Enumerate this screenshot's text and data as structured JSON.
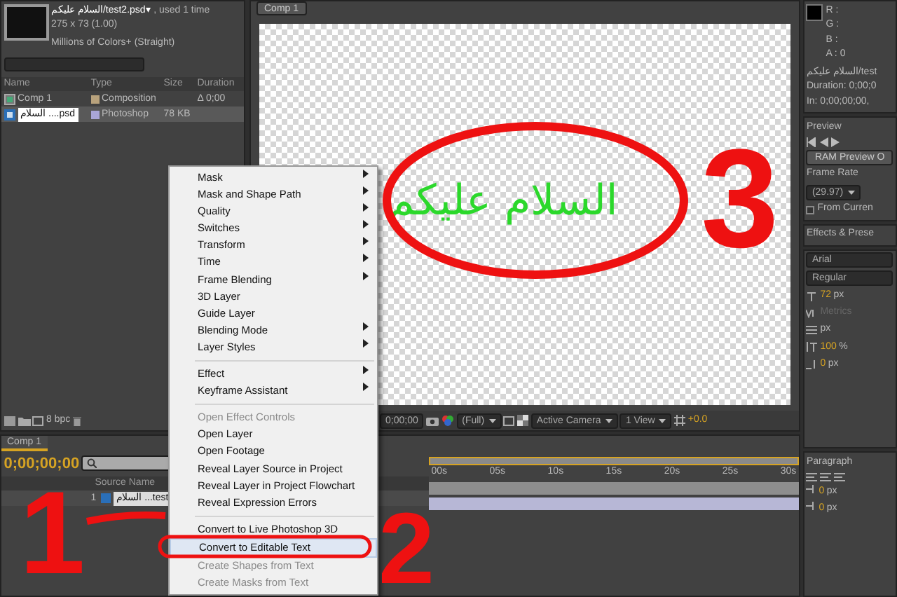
{
  "project": {
    "footage_name": "السلام عليكم/test2.psd▾",
    "footage_usage": ", used 1 time",
    "dimensions": "275 x 73 (1.00)",
    "color_depth": "Millions of Colors+ (Straight)",
    "columns": [
      "Name",
      "Type",
      "Size",
      "Duration"
    ],
    "items": [
      {
        "name": "Comp 1",
        "type": "Composition",
        "duration": "Δ 0;00",
        "color": "#b8a27c",
        "kind": "comp",
        "selected": false
      },
      {
        "name": "السلام ....psd",
        "type": "Photoshop",
        "size": "78 KB",
        "color": "#a9a6d6",
        "kind": "footage",
        "selected": true
      }
    ],
    "bit_depth": "8 bpc"
  },
  "viewer": {
    "tab": "Comp 1",
    "canvas_text": "السلام عليكم",
    "timecode": "0;00;00",
    "resolution": "(Full)",
    "camera": "Active Camera",
    "views": "1 View",
    "exposure": "+0.0"
  },
  "context_menu": {
    "groups": [
      [
        {
          "label": "Mask",
          "submenu": true,
          "disabled": false,
          "selected": false
        },
        {
          "label": "Mask and Shape Path",
          "submenu": true,
          "disabled": false,
          "selected": false
        },
        {
          "label": "Quality",
          "submenu": true,
          "disabled": false,
          "selected": false
        },
        {
          "label": "Switches",
          "submenu": true,
          "disabled": false,
          "selected": false
        },
        {
          "label": "Transform",
          "submenu": true,
          "disabled": false,
          "selected": false
        },
        {
          "label": "Time",
          "submenu": true,
          "disabled": false,
          "selected": false
        },
        {
          "label": "Frame Blending",
          "submenu": true,
          "disabled": false,
          "selected": false
        },
        {
          "label": "3D Layer",
          "submenu": false,
          "disabled": false,
          "selected": false
        },
        {
          "label": "Guide Layer",
          "submenu": false,
          "disabled": false,
          "selected": false
        },
        {
          "label": "Blending Mode",
          "submenu": true,
          "disabled": false,
          "selected": false
        },
        {
          "label": "Layer Styles",
          "submenu": true,
          "disabled": false,
          "selected": false
        }
      ],
      [
        {
          "label": "Effect",
          "submenu": true,
          "disabled": false,
          "selected": false
        },
        {
          "label": "Keyframe Assistant",
          "submenu": true,
          "disabled": false,
          "selected": false
        }
      ],
      [
        {
          "label": "Open Effect Controls",
          "submenu": false,
          "disabled": true,
          "selected": false
        },
        {
          "label": "Open Layer",
          "submenu": false,
          "disabled": false,
          "selected": false
        },
        {
          "label": "Open Footage",
          "submenu": false,
          "disabled": false,
          "selected": false
        },
        {
          "label": "Reveal Layer Source in Project",
          "submenu": false,
          "disabled": false,
          "selected": false
        },
        {
          "label": "Reveal Layer in Project Flowchart",
          "submenu": false,
          "disabled": false,
          "selected": false
        },
        {
          "label": "Reveal Expression Errors",
          "submenu": false,
          "disabled": false,
          "selected": false
        }
      ],
      [
        {
          "label": "Convert to Live Photoshop 3D",
          "submenu": false,
          "disabled": false,
          "selected": false
        },
        {
          "label": "Convert to Editable Text",
          "submenu": false,
          "disabled": false,
          "selected": true
        },
        {
          "label": "Create Shapes from Text",
          "submenu": false,
          "disabled": true,
          "selected": false
        },
        {
          "label": "Create Masks from Text",
          "submenu": false,
          "disabled": true,
          "selected": false
        }
      ]
    ]
  },
  "timeline": {
    "tab": "Comp 1",
    "timecode": "0;00;00;00",
    "source_header": "Source Name",
    "layer_number": "1",
    "layer_name": "السلام ...test",
    "ruler": [
      "00s",
      "05s",
      "10s",
      "15s",
      "20s",
      "25s",
      "30s"
    ]
  },
  "info": {
    "channels": [
      "R :",
      "G :",
      "B :",
      "A : 0"
    ],
    "layer": "السلام عليكم/test",
    "duration": "Duration: 0;00;0",
    "in_point": "In: 0;00;00;00,"
  },
  "preview": {
    "tab": "Preview",
    "ram_button": "RAM Preview O",
    "frame_rate_label": "Frame Rate",
    "frame_rate": "(29.97)",
    "from_current": "From Curren",
    "from_current_checked": false
  },
  "effects": {
    "tab": "Effects & Prese"
  },
  "character": {
    "font": "Arial",
    "style": "Regular",
    "size": "72",
    "size_unit": "px",
    "kerning": "Metrics",
    "leading_unit": "px",
    "scale": "100",
    "scale_unit": "%",
    "shift": "0",
    "shift_unit": "px"
  },
  "paragraph": {
    "tab": "Paragraph",
    "indents": [
      {
        "value": "0",
        "unit": "px"
      },
      {
        "value": "0",
        "unit": "px"
      }
    ]
  },
  "annotations": [
    "3",
    "1",
    "2"
  ]
}
